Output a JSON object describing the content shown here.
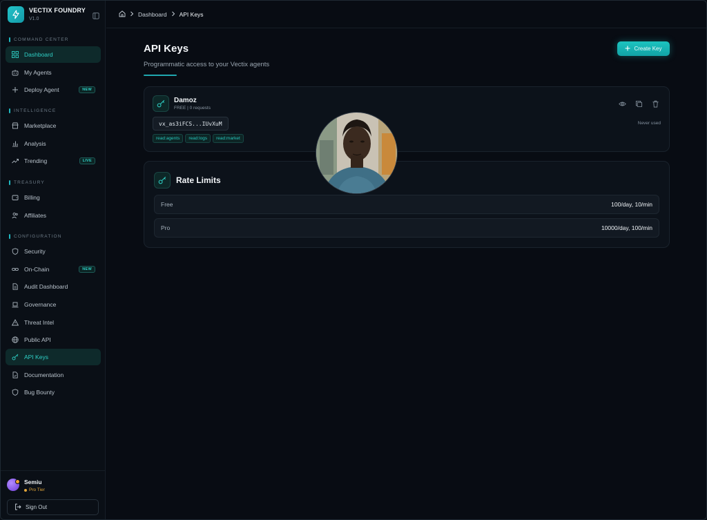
{
  "brand": {
    "name": "VECTIX FOUNDRY",
    "version": "V1.0",
    "accent": "#20c0c4"
  },
  "sidebar": {
    "sections": [
      {
        "title": "COMMAND CENTER",
        "items": [
          {
            "label": "Dashboard",
            "icon": "grid-icon",
            "active": true
          },
          {
            "label": "My Agents",
            "icon": "robot-icon"
          },
          {
            "label": "Deploy Agent",
            "icon": "plus-icon",
            "badge": "NEW"
          }
        ]
      },
      {
        "title": "INTELLIGENCE",
        "items": [
          {
            "label": "Marketplace",
            "icon": "store-icon"
          },
          {
            "label": "Analysis",
            "icon": "bar-chart-icon"
          },
          {
            "label": "Trending",
            "icon": "trending-icon",
            "badge": "LIVE"
          }
        ]
      },
      {
        "title": "TREASURY",
        "items": [
          {
            "label": "Billing",
            "icon": "wallet-icon"
          },
          {
            "label": "Affiliates",
            "icon": "users-icon"
          }
        ]
      },
      {
        "title": "CONFIGURATION",
        "items": [
          {
            "label": "Security",
            "icon": "shield-icon"
          },
          {
            "label": "On-Chain",
            "icon": "link-icon",
            "badge": "NEW"
          },
          {
            "label": "Audit Dashboard",
            "icon": "file-icon"
          },
          {
            "label": "Governance",
            "icon": "governance-icon"
          },
          {
            "label": "Threat Intel",
            "icon": "warning-icon"
          },
          {
            "label": "Public API",
            "icon": "globe-icon"
          },
          {
            "label": "API Keys",
            "icon": "key-icon",
            "active": true
          },
          {
            "label": "Documentation",
            "icon": "document-icon"
          },
          {
            "label": "Bug Bounty",
            "icon": "shield-icon"
          }
        ]
      }
    ]
  },
  "user": {
    "name": "Semiu",
    "tier": "Pro Tier",
    "signout": "Sign Out"
  },
  "breadcrumb": {
    "items": [
      "Dashboard",
      "API Keys"
    ]
  },
  "page": {
    "title": "API Keys",
    "subtitle": "Programmatic access to your Vectix agents",
    "create_label": "Create Key"
  },
  "keys": [
    {
      "name": "Damoz",
      "meta": "FREE | 0 requests",
      "value": "vx_as3iFCS...IUvXuM",
      "scopes": [
        "read:agents",
        "read:logs",
        "read:market"
      ],
      "last_used": "Never used"
    }
  ],
  "rate_limits": {
    "title": "Rate Limits",
    "rows": [
      {
        "tier": "Free",
        "limit": "100/day, 10/min"
      },
      {
        "tier": "Pro",
        "limit": "10000/day, 100/min"
      }
    ]
  }
}
